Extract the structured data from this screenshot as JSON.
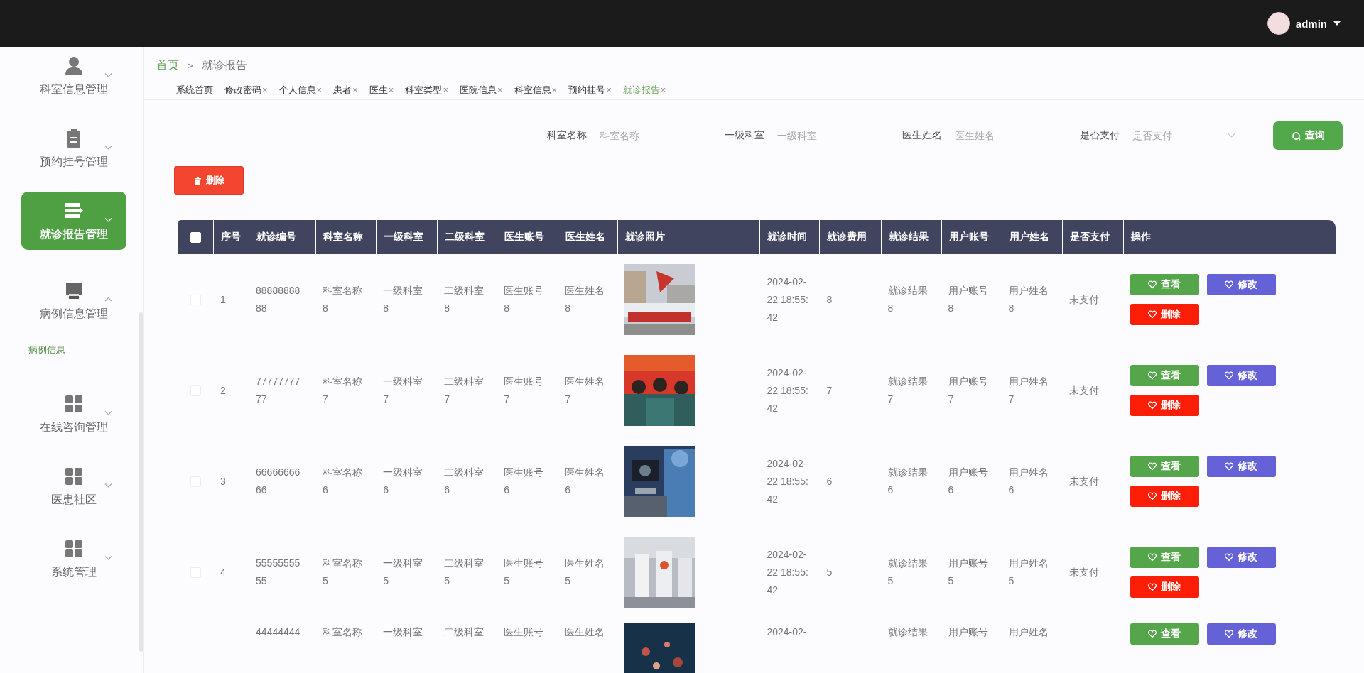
{
  "top_bar": {
    "user": "admin"
  },
  "sidebar": {
    "items": [
      {
        "label": "科室信息管理",
        "selected": false,
        "expanded": false
      },
      {
        "label": "预约挂号管理",
        "selected": false,
        "expanded": false
      },
      {
        "label": "就诊报告管理",
        "selected": true,
        "expanded": false
      },
      {
        "label": "病例信息管理",
        "selected": false,
        "expanded": true,
        "children": [
          {
            "label": "病例信息"
          }
        ]
      },
      {
        "label": "在线咨询管理",
        "selected": false,
        "expanded": false
      },
      {
        "label": "医患社区",
        "selected": false,
        "expanded": false
      },
      {
        "label": "系统管理",
        "selected": false,
        "expanded": false
      }
    ]
  },
  "breadcrumb": [
    "首页",
    "就诊报告"
  ],
  "breadcrumb_separator": ">",
  "tabs": [
    {
      "label": "系统首页",
      "selected": false
    },
    {
      "label": "修改密码",
      "close": "×",
      "selected": false
    },
    {
      "label": "个人信息",
      "close": "×",
      "selected": false
    },
    {
      "label": "患者",
      "close": "×",
      "selected": false
    },
    {
      "label": "医生",
      "close": "×",
      "selected": false
    },
    {
      "label": "科室类型",
      "close": "×",
      "selected": false
    },
    {
      "label": "医院信息",
      "close": "×",
      "selected": false
    },
    {
      "label": "科室信息",
      "close": "×",
      "selected": false
    },
    {
      "label": "预约挂号",
      "close": "×",
      "selected": false
    },
    {
      "label": "就诊报告",
      "close": "×",
      "selected": true
    }
  ],
  "search": {
    "fields": [
      {
        "label": "科室名称",
        "placeholder": "科室名称",
        "kind": "input"
      },
      {
        "label": "一级科室",
        "placeholder": "一级科室",
        "kind": "input"
      },
      {
        "label": "医生姓名",
        "placeholder": "医生姓名",
        "kind": "input"
      },
      {
        "label": "是否支付",
        "placeholder": "是否支付",
        "kind": "select"
      }
    ],
    "button": "查询"
  },
  "delete_button": "删除",
  "table": {
    "all_checked": false,
    "columns": [
      {
        "label": "序号",
        "kind": "text"
      },
      {
        "label": "就诊编号",
        "kind": "text"
      },
      {
        "label": "科室名称",
        "kind": "text"
      },
      {
        "label": "一级科室",
        "kind": "text"
      },
      {
        "label": "二级科室",
        "kind": "text"
      },
      {
        "label": "医生账号",
        "kind": "text"
      },
      {
        "label": "医生姓名",
        "kind": "text"
      },
      {
        "label": "就诊照片",
        "kind": "picture"
      },
      {
        "label": "就诊时间",
        "kind": "text"
      },
      {
        "label": "就诊费用",
        "kind": "text"
      },
      {
        "label": "就诊结果",
        "kind": "text"
      },
      {
        "label": "用户账号",
        "kind": "text"
      },
      {
        "label": "用户姓名",
        "kind": "text"
      },
      {
        "label": "是否支付",
        "kind": "text"
      },
      {
        "label": "操作",
        "kind": "actions"
      }
    ],
    "rows": [
      {
        "checked": false,
        "cells": [
          "1",
          "8888888888",
          "科室名称8",
          "一级科室8",
          "二级科室8",
          "医生账号8",
          "医生姓名8",
          {
            "kind": "picture"
          },
          "2024-02-22 18:55:42",
          "8",
          "就诊结果8",
          "用户账号8",
          "用户姓名8",
          "未支付",
          [
            {
              "label": "查看",
              "kind": "view"
            },
            {
              "label": "修改",
              "kind": "edit"
            },
            {
              "label": "删除",
              "kind": "delete"
            }
          ]
        ]
      },
      {
        "checked": false,
        "cells": [
          "2",
          "7777777777",
          "科室名称7",
          "一级科室7",
          "二级科室7",
          "医生账号7",
          "医生姓名7",
          {
            "kind": "picture"
          },
          "2024-02-22 18:55:42",
          "7",
          "就诊结果7",
          "用户账号7",
          "用户姓名7",
          "未支付",
          [
            {
              "label": "查看",
              "kind": "view"
            },
            {
              "label": "修改",
              "kind": "edit"
            },
            {
              "label": "删除",
              "kind": "delete"
            }
          ]
        ]
      },
      {
        "checked": false,
        "cells": [
          "3",
          "6666666666",
          "科室名称6",
          "一级科室6",
          "二级科室6",
          "医生账号6",
          "医生姓名6",
          {
            "kind": "picture"
          },
          "2024-02-22 18:55:42",
          "6",
          "就诊结果6",
          "用户账号6",
          "用户姓名6",
          "未支付",
          [
            {
              "label": "查看",
              "kind": "view"
            },
            {
              "label": "修改",
              "kind": "edit"
            },
            {
              "label": "删除",
              "kind": "delete"
            }
          ]
        ]
      },
      {
        "checked": false,
        "cells": [
          "4",
          "5555555555",
          "科室名称5",
          "一级科室5",
          "二级科室5",
          "医生账号5",
          "医生姓名5",
          {
            "kind": "picture"
          },
          "2024-02-22 18:55:42",
          "5",
          "就诊结果5",
          "用户账号5",
          "用户姓名5",
          "未支付",
          [
            {
              "label": "查看",
              "kind": "view"
            },
            {
              "label": "修改",
              "kind": "edit"
            },
            {
              "label": "删除",
              "kind": "delete"
            }
          ]
        ]
      },
      {
        "cells": [
          null,
          "44444444",
          "科室名称",
          "一级科室",
          "二级科室",
          "医生账号",
          "医生姓名",
          {
            "kind": "picture"
          },
          "2024-02-",
          null,
          "就诊结果",
          "用户账号",
          "用户姓名",
          null,
          [
            {
              "label": "查看",
              "kind": "view"
            },
            {
              "label": "修改",
              "kind": "edit"
            }
          ]
        ]
      }
    ]
  }
}
